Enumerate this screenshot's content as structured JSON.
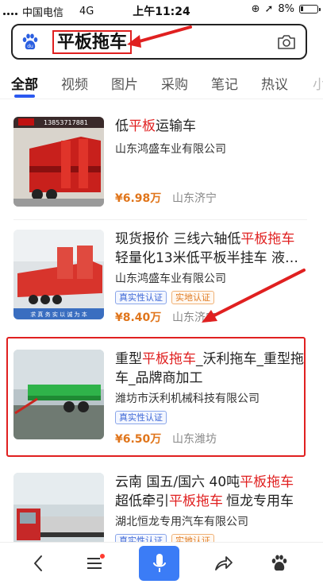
{
  "status_bar": {
    "carrier": "中国电信",
    "network": "4G",
    "time": "上午11:24",
    "battery": "8%"
  },
  "search": {
    "query": "平板拖车"
  },
  "tabs": [
    "全部",
    "视频",
    "图片",
    "采购",
    "笔记",
    "热议",
    "小"
  ],
  "results": [
    {
      "title_parts": [
        "低",
        "平板",
        "运输车"
      ],
      "company": "山东鸿盛车业有限公司",
      "price": "¥6.98万",
      "location": "山东济宁",
      "thumb_caption": "13853717881"
    },
    {
      "title_parts": [
        "现货报价 三线六轴低",
        "平板拖车",
        "轻量化13米低平板半挂车 液…"
      ],
      "company": "山东鸿盛车业有限公司",
      "badges": [
        "真实性认证",
        "实地认证"
      ],
      "price": "¥8.40万",
      "location": "山东济宁",
      "thumb_caption": "求 真 务 实   以 诚 为 本"
    },
    {
      "title_parts": [
        "重型",
        "平板拖车",
        "_沃利拖车_重型拖车_品牌商加工"
      ],
      "company": "潍坊市沃利机械科技有限公司",
      "badges": [
        "真实性认证"
      ],
      "price": "¥6.50万",
      "location": "山东潍坊"
    },
    {
      "title_parts": [
        "云南 国五/国六 40吨",
        "平板拖车",
        "超低牵引",
        "平板拖车",
        "恒龙专用车"
      ],
      "company": "湖北恒龙专用汽车有限公司",
      "badges": [
        "真实性认证",
        "实地认证"
      ]
    }
  ],
  "colors": {
    "highlight": "#e02020",
    "tab_underline": "#2a58f0",
    "price": "#e0751b",
    "mic_button": "#3b7cf6"
  }
}
